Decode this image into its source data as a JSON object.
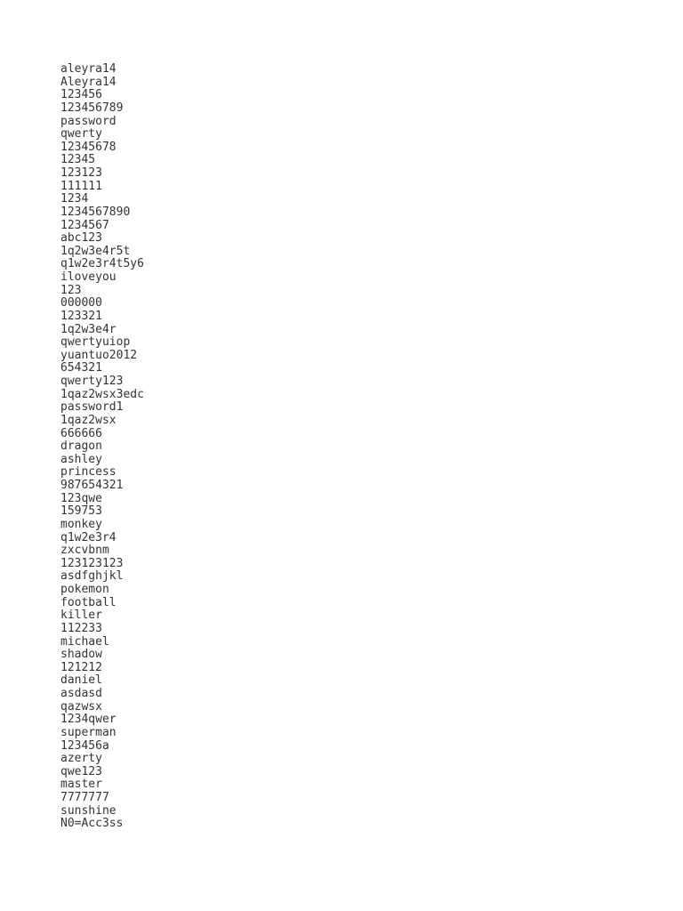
{
  "document": {
    "background_color": "#ffffff",
    "text_color": "#333333",
    "line_count": 60,
    "lines": [
      "aleyra14",
      "Aleyra14",
      "123456",
      "123456789",
      "password",
      "qwerty",
      "12345678",
      "12345",
      "123123",
      "111111",
      "1234",
      "1234567890",
      "1234567",
      "abc123",
      "1q2w3e4r5t",
      "q1w2e3r4t5y6",
      "iloveyou",
      "123",
      "000000",
      "123321",
      "1q2w3e4r",
      "qwertyuiop",
      "yuantuo2012",
      "654321",
      "qwerty123",
      "1qaz2wsx3edc",
      "password1",
      "1qaz2wsx",
      "666666",
      "dragon",
      "ashley",
      "princess",
      "987654321",
      "123qwe",
      "159753",
      "monkey",
      "q1w2e3r4",
      "zxcvbnm",
      "123123123",
      "asdfghjkl",
      "pokemon",
      "football",
      "killer",
      "112233",
      "michael",
      "shadow",
      "121212",
      "daniel",
      "asdasd",
      "qazwsx",
      "1234qwer",
      "superman",
      "123456a",
      "azerty",
      "qwe123",
      "master",
      "7777777",
      "sunshine",
      "N0=Acc3ss"
    ]
  }
}
